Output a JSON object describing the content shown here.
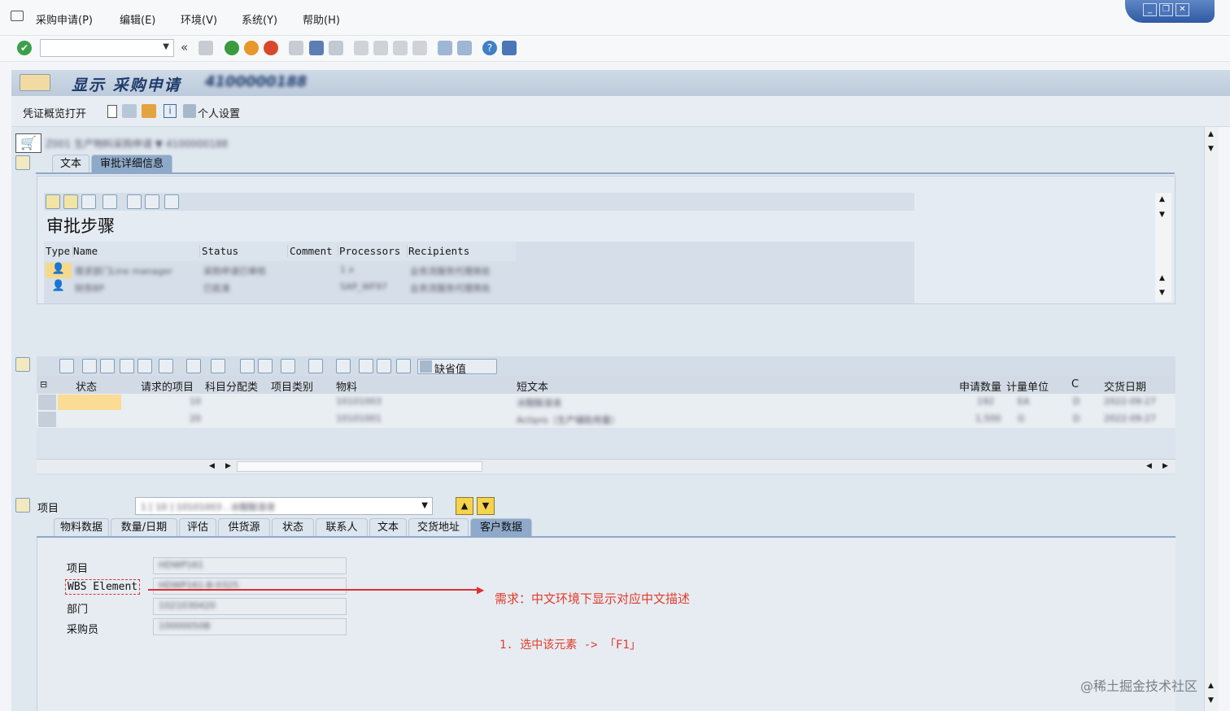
{
  "menu": [
    "采购申请(P)",
    "编辑(E)",
    "环境(V)",
    "系统(Y)",
    "帮助(H)"
  ],
  "title": "显示  采购申请",
  "title_doc_number": "4100000188",
  "appbar": {
    "overview": "凭证概览打开",
    "personal": "个人设置"
  },
  "header_doc": "Z001 生产物料采购申请  ▼ 4100000188",
  "header_tabs": [
    "文本",
    "审批详细信息"
  ],
  "approval": {
    "heading": "审批步骤",
    "columns": [
      "Type",
      "Name",
      "Status",
      "Comment",
      "Processors",
      "Recipients"
    ],
    "rows": [
      {
        "name": "需求部门Line manager",
        "status": "采购申请已审核",
        "processors": "1 x",
        "recipients": "业务流服务代理商处"
      },
      {
        "name": "财务BP",
        "status": "已批准",
        "processors": "SAP_WF97",
        "recipients": "业务流服务代理商处"
      }
    ]
  },
  "items_toolbar": {
    "default_btn": "缺省值"
  },
  "items_table": {
    "columns": [
      "状态",
      "请求的项目",
      "科目分配类",
      "项目类别",
      "物料",
      "短文本",
      "申请数量",
      "计量单位",
      "C",
      "交货日期"
    ],
    "rows": [
      {
        "item": "10",
        "material": "10101003",
        "text": "冰醋酸溶液",
        "qty": "192",
        "unit": "EA",
        "c": "D",
        "date": "2022-09-27"
      },
      {
        "item": "20",
        "material": "10101001",
        "text": "Actipro（生产辅助用量）",
        "qty": "1,500",
        "unit": "G",
        "c": "D",
        "date": "2022-09-27"
      }
    ]
  },
  "item_detail": {
    "label": "项目",
    "selector": "1 [ 10 ] 10101003 , 冰醋酸溶液",
    "tabs": [
      "物料数据",
      "数量/日期",
      "评估",
      "供货源",
      "状态",
      "联系人",
      "文本",
      "交货地址",
      "客户数据"
    ],
    "fields": [
      {
        "label": "项目",
        "value": "HDWP161"
      },
      {
        "label": "WBS Element",
        "value": "HDWP161-B-0325"
      },
      {
        "label": "部门",
        "value": "1021030420"
      },
      {
        "label": "采购员",
        "value": "10000050B"
      }
    ]
  },
  "annotation": {
    "requirement": "需求：中文环境下显示对应中文描述",
    "step": "1. 选中该元素 -> 「F1」"
  },
  "watermark": "@稀土掘金技术社区"
}
